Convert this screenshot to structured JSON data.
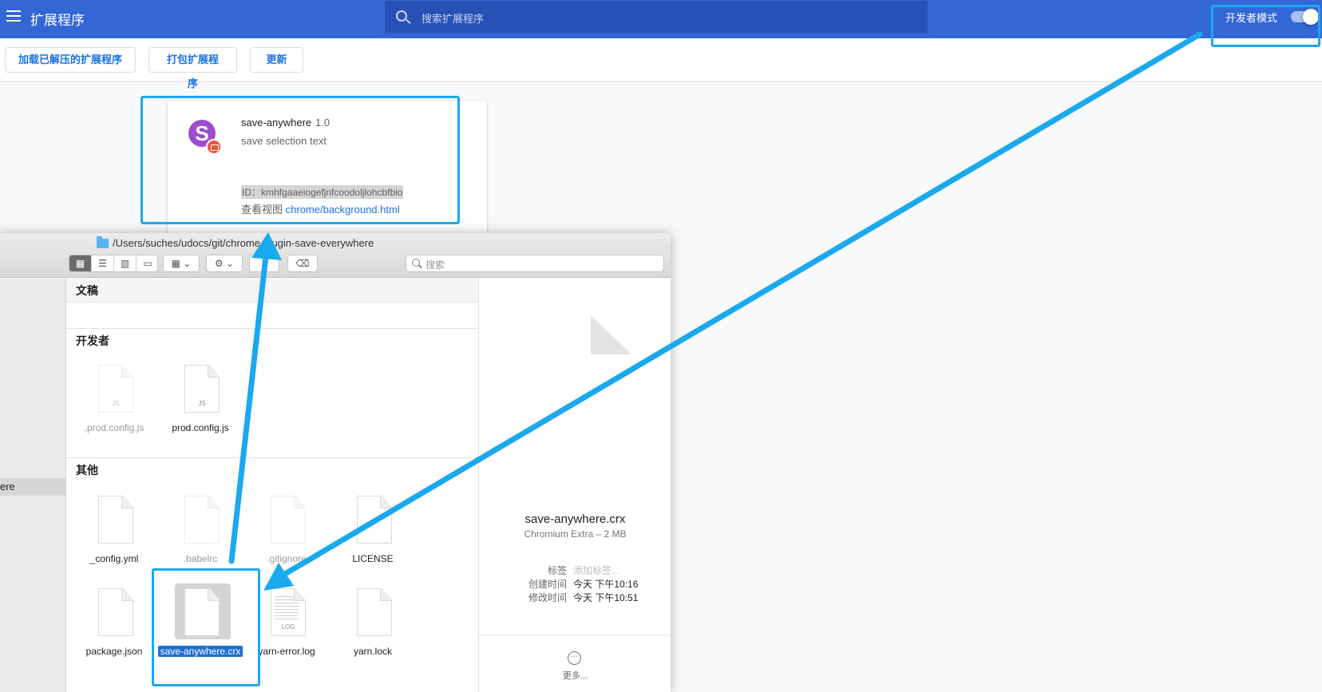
{
  "chrome": {
    "page_title": "扩展程序",
    "search_placeholder": "搜索扩展程序",
    "dev_mode_label": "开发者模式",
    "dev_mode_on": true,
    "toolbar": {
      "load_unpacked": "加载已解压的扩展程序",
      "pack": "打包扩展程序",
      "update": "更新"
    },
    "extension": {
      "logo_letter": "S",
      "name": "save-anywhere",
      "version": "1.0",
      "description": "save selection text",
      "id_line": "ID：kmhfgaaeiogefjnfcoodoljlohcbfbio",
      "views_label": "查看视图",
      "views_link": "chrome/background.html"
    }
  },
  "finder": {
    "path": "/Users/suches/udocs/git/chrome-plugin-save-everywhere",
    "search_placeholder": "搜索",
    "sidebar_item": "ere",
    "groups": {
      "docs": "文稿",
      "developer": "开发者",
      "other": "其他"
    },
    "developer_files": [
      {
        "name": ".prod.config.js",
        "tag": "JS"
      },
      {
        "name": "prod.config.js",
        "tag": "JS"
      }
    ],
    "other_files": [
      {
        "name": "_config.yml"
      },
      {
        "name": ".babelrc"
      },
      {
        "name": ".gitignore"
      },
      {
        "name": "LICENSE"
      },
      {
        "name": "package.json"
      },
      {
        "name": "save-anywhere.crx"
      },
      {
        "name": "yarn-error.log",
        "tag": "LOG"
      },
      {
        "name": "yarn.lock"
      }
    ],
    "preview": {
      "file_name": "save-anywhere.crx",
      "kind": "Chromium Extra – 2 MB",
      "tags_key": "标签",
      "tags_placeholder": "添加标签...",
      "created_key": "创建时间",
      "created_val": "今天 下午10:16",
      "modified_key": "修改时间",
      "modified_val": "今天 下午10:51",
      "more_label": "更多..."
    }
  },
  "colors": {
    "chrome_blue": "#3367d6",
    "annotation": "#1aa9ef",
    "selection": "#1f6fd1"
  }
}
